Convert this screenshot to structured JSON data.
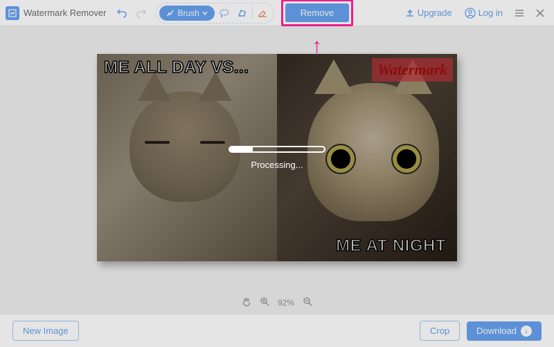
{
  "app": {
    "title": "Watermark Remover"
  },
  "toolbar": {
    "brush_label": "Brush",
    "remove_label": "Remove",
    "upgrade_label": "Upgrade",
    "login_label": "Log in"
  },
  "meme": {
    "top_left": "ME ALL DAY VS...",
    "bottom_right": "ME AT NIGHT",
    "watermark_label": "Watermark"
  },
  "processing": {
    "label": "Processing..."
  },
  "zoom": {
    "level": "92%"
  },
  "footer": {
    "new_image_label": "New Image",
    "crop_label": "Crop",
    "download_label": "Download"
  },
  "colors": {
    "accent": "#2f7eea",
    "annotation": "#e91e8c"
  }
}
